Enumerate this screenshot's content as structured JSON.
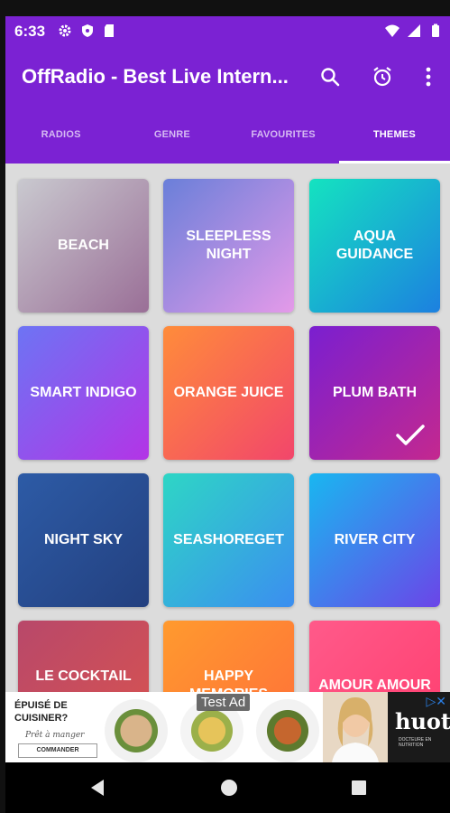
{
  "status_bar": {
    "time": "6:33"
  },
  "app": {
    "title": "OffRadio - Best Live Intern..."
  },
  "tabs": [
    {
      "label": "RADIOS",
      "active": false
    },
    {
      "label": "GENRE",
      "active": false
    },
    {
      "label": "FAVOURITES",
      "active": false
    },
    {
      "label": "THEMES",
      "active": true
    }
  ],
  "themes": [
    {
      "label": "BEACH",
      "colors": [
        "#c9c9cf",
        "#9a6f97"
      ]
    },
    {
      "label": "SLEEPLESS NIGHT",
      "colors": [
        "#6a7fd9",
        "#e49ae9"
      ]
    },
    {
      "label": "AQUA GUIDANCE",
      "colors": [
        "#14e3c0",
        "#1c80e0"
      ]
    },
    {
      "label": "SMART INDIGO",
      "colors": [
        "#6d74f4",
        "#b334e6"
      ]
    },
    {
      "label": "ORANGE JUICE",
      "colors": [
        "#ff8c3a",
        "#f2466b"
      ]
    },
    {
      "label": "PLUM BATH",
      "colors": [
        "#7a1fd0",
        "#c4288f"
      ],
      "selected": true
    },
    {
      "label": "NIGHT SKY",
      "colors": [
        "#2d5ba6",
        "#23407f"
      ]
    },
    {
      "label": "SEASHOREGET",
      "colors": [
        "#2ed6c5",
        "#3b8ef0"
      ]
    },
    {
      "label": "RIVER CITY",
      "colors": [
        "#19b7f0",
        "#6b45e8"
      ]
    },
    {
      "label": "LE COCKTAIL",
      "colors": [
        "#b8486a",
        "#d9534f"
      ]
    },
    {
      "label": "HAPPY MEMORIES",
      "colors": [
        "#ff9a2e",
        "#ff6e3a"
      ]
    },
    {
      "label": "AMOUR AMOUR",
      "colors": [
        "#ff5a8a",
        "#ff3d6e"
      ]
    }
  ],
  "ad": {
    "headline": "ÉPUISÉ DE CUISINER?",
    "tagline": "Prêt à manger",
    "cta": "COMMANDER",
    "test_label": "Test Ad",
    "brand": "huot",
    "brand_sub": "DOCTEURE EN NUTRITION"
  },
  "icons": {
    "search": "search-icon",
    "alarm": "alarm-icon",
    "more": "more-vert-icon"
  }
}
